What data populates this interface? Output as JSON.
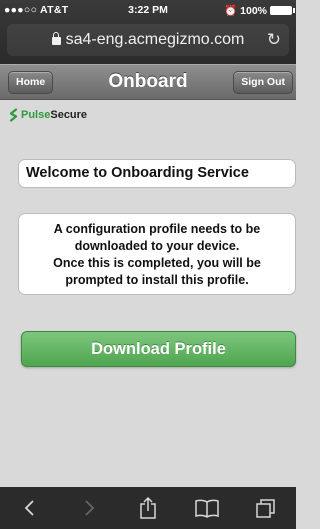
{
  "status_bar": {
    "carrier": "●●●○○ AT&T",
    "time": "3:22 PM",
    "battery": "100%"
  },
  "browser": {
    "url": "sa4-eng.acmegizmo.com",
    "icons": [
      "lock-icon",
      "reload-icon",
      "back-icon",
      "forward-icon",
      "share-icon",
      "bookmarks-icon",
      "tabs-icon"
    ]
  },
  "header": {
    "home_label": "Home",
    "title": "Onboard",
    "signout_label": "Sign Out"
  },
  "logo": {
    "pulse": "Pulse",
    "secure": "Secure",
    "brand_color": "#2f9a3f"
  },
  "main": {
    "welcome": "Welcome to Onboarding Service",
    "info_lines": [
      "A configuration profile needs to be",
      "downloaded to your device.",
      "Once this is completed, you will be",
      "prompted to install this profile."
    ],
    "download_label": "Download Profile",
    "download_color": "#5fb35f"
  }
}
